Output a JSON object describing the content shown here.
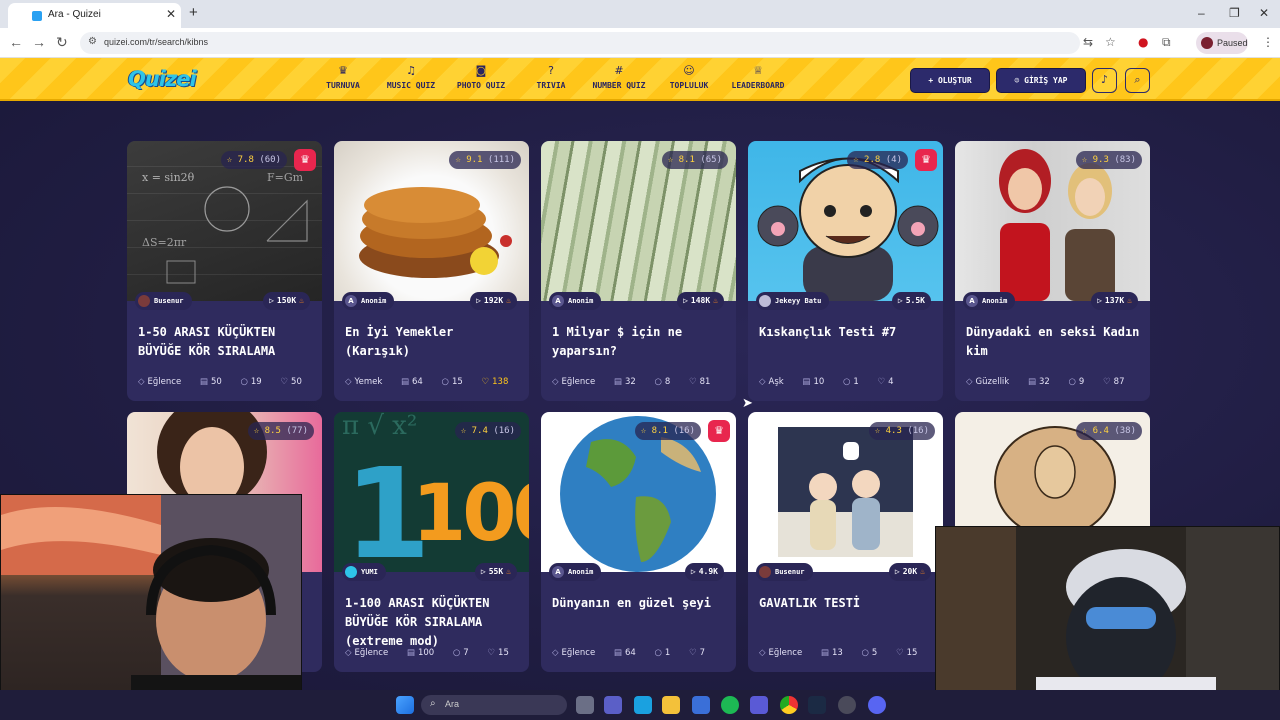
{
  "browser": {
    "tab_title": "Ara - Quizei",
    "url": "quizei.com/tr/search/kibns",
    "profile_status": "Paused"
  },
  "site": {
    "logo": "Quizei",
    "nav": [
      {
        "icon": "trophy-icon",
        "label": "TURNUVA"
      },
      {
        "icon": "music-icon",
        "label": "MUSIC QUIZ"
      },
      {
        "icon": "camera-icon",
        "label": "PHOTO QUIZ"
      },
      {
        "icon": "question-icon",
        "label": "TRIVIA"
      },
      {
        "icon": "hash-icon",
        "label": "NUMBER QUIZ"
      },
      {
        "icon": "community-icon",
        "label": "TOPLULUK"
      },
      {
        "icon": "leaderboard-icon",
        "label": "LEADERBOARD"
      }
    ],
    "create_button": "+ OLUŞTUR",
    "login_button": "GİRİŞ YAP"
  },
  "cards": [
    {
      "rating": "7.8",
      "votes": "(60)",
      "premium": true,
      "author": "Busenur",
      "author_initial": "",
      "plays": "150K",
      "hot": true,
      "title": "1-50 ARASI KÜÇÜKTEN BÜYÜĞE KÖR SIRALAMA",
      "category": "Eğlence",
      "questions": "50",
      "comments": "19",
      "likes": "50",
      "liked": false
    },
    {
      "rating": "9.1",
      "votes": "(111)",
      "premium": false,
      "author": "Anonim",
      "author_initial": "A",
      "plays": "192K",
      "hot": true,
      "title": "En İyi Yemekler (Karışık)",
      "category": "Yemek",
      "questions": "64",
      "comments": "15",
      "likes": "138",
      "liked": true
    },
    {
      "rating": "8.1",
      "votes": "(65)",
      "premium": false,
      "author": "Anonim",
      "author_initial": "A",
      "plays": "148K",
      "hot": true,
      "title": "1 Milyar $ için ne yaparsın?",
      "category": "Eğlence",
      "questions": "32",
      "comments": "8",
      "likes": "81",
      "liked": false
    },
    {
      "rating": "2.8",
      "votes": "(4)",
      "premium": true,
      "author": "Jekeyy Batu",
      "author_initial": "",
      "plays": "5.5K",
      "hot": false,
      "title": "Kıskançlık Testi #7",
      "category": "Aşk",
      "questions": "10",
      "comments": "1",
      "likes": "4",
      "liked": false
    },
    {
      "rating": "9.3",
      "votes": "(83)",
      "premium": false,
      "author": "Anonim",
      "author_initial": "A",
      "plays": "137K",
      "hot": true,
      "title": "Dünyadaki en seksi Kadın kim",
      "category": "Güzellik",
      "questions": "32",
      "comments": "9",
      "likes": "87",
      "liked": false
    },
    {
      "rating": "8.5",
      "votes": "(77)",
      "premium": false,
      "author": "",
      "author_initial": "",
      "plays": "",
      "hot": false,
      "title": "",
      "category": "",
      "questions": "",
      "comments": "",
      "likes": "54",
      "liked": false
    },
    {
      "rating": "7.4",
      "votes": "(16)",
      "premium": false,
      "author": "YUMI",
      "author_initial": "",
      "plays": "55K",
      "hot": true,
      "title": "1-100 ARASI KÜÇÜKTEN BÜYÜĞE KÖR SIRALAMA (extreme mod)",
      "category": "Eğlence",
      "questions": "100",
      "comments": "7",
      "likes": "15",
      "liked": false
    },
    {
      "rating": "8.1",
      "votes": "(16)",
      "premium": true,
      "author": "Anonim",
      "author_initial": "A",
      "plays": "4.9K",
      "hot": false,
      "title": "Dünyanın en güzel şeyi",
      "category": "Eğlence",
      "questions": "64",
      "comments": "1",
      "likes": "7",
      "liked": false
    },
    {
      "rating": "4.3",
      "votes": "(16)",
      "premium": false,
      "author": "Busenur",
      "author_initial": "",
      "plays": "20K",
      "hot": true,
      "title": "GAVATLIK TESTİ",
      "category": "Eğlence",
      "questions": "13",
      "comments": "5",
      "likes": "15",
      "liked": false
    },
    {
      "rating": "6.4",
      "votes": "(38)",
      "premium": false,
      "author": "",
      "author_initial": "",
      "plays": "",
      "hot": false,
      "title": "",
      "category": "",
      "questions": "",
      "comments": "",
      "likes": "",
      "liked": false
    }
  ],
  "taskbar": {
    "search_placeholder": "Ara"
  },
  "colors": {
    "header_yellow": "#ffd233",
    "accent_navy": "#2c2a6b",
    "premium_red": "#e8264e",
    "rating_gold": "#ffd23f",
    "page_bg": "#1e1b3c"
  }
}
